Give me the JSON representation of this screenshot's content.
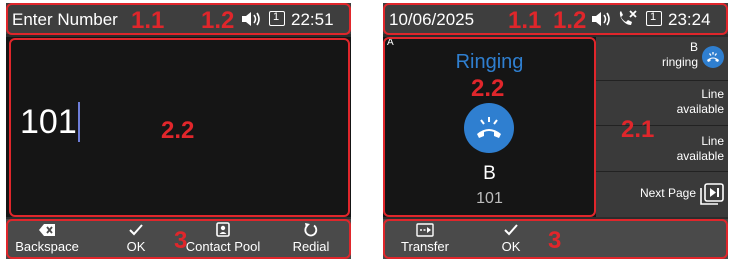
{
  "left": {
    "status": {
      "title": "Enter Number",
      "time": "22:51",
      "line_number": "1"
    },
    "entry": {
      "value": "101"
    },
    "softkeys": [
      {
        "label": "Backspace",
        "icon": "backspace-icon"
      },
      {
        "label": "OK",
        "icon": "check-icon"
      },
      {
        "label": "Contact Pool",
        "icon": "contact-book-icon"
      },
      {
        "label": "Redial",
        "icon": "redial-icon"
      }
    ]
  },
  "right": {
    "status": {
      "date": "10/06/2025",
      "time": "23:24",
      "line_number": "1"
    },
    "call": {
      "account": "A",
      "state": "Ringing",
      "name": "B",
      "number": "101"
    },
    "line_keys": [
      {
        "name": "B",
        "state": "ringing"
      },
      {
        "line": "Line",
        "state": "available"
      },
      {
        "line": "Line",
        "state": "available"
      },
      {
        "label": "Next Page"
      }
    ],
    "softkeys": [
      {
        "label": "Transfer",
        "icon": "transfer-icon"
      },
      {
        "label": "OK",
        "icon": "check-icon"
      }
    ]
  },
  "annotations": {
    "status_bar_left": "1.1",
    "status_icons": "1.2",
    "main_area": "2.2",
    "line_keys": "2.1",
    "softkey_bar": "3"
  },
  "colors": {
    "accent_blue": "#2f7fd0",
    "annotation_red": "#e0262b"
  }
}
